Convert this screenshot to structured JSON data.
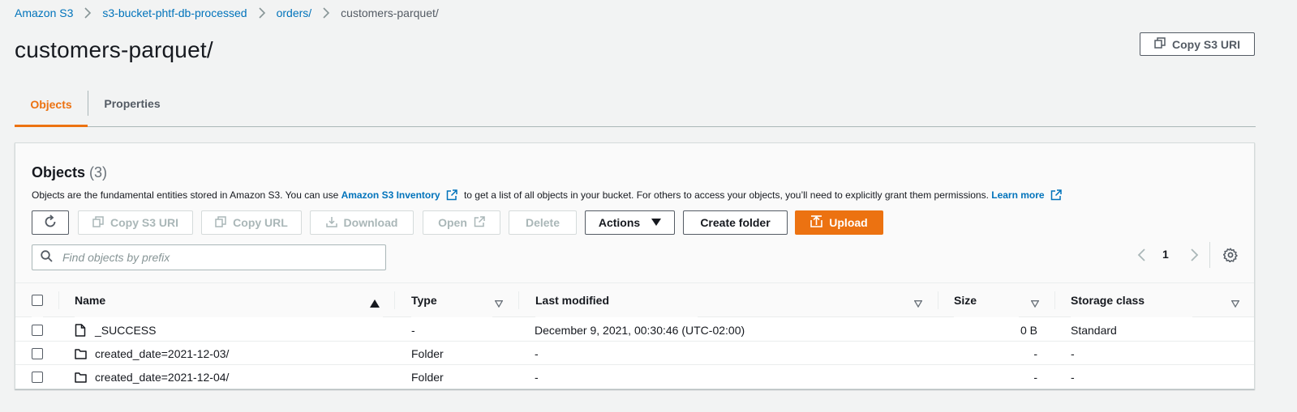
{
  "breadcrumb": {
    "items": [
      {
        "label": "Amazon S3"
      },
      {
        "label": "s3-bucket-phtf-db-processed"
      },
      {
        "label": "orders/"
      }
    ],
    "current": "customers-parquet/"
  },
  "page": {
    "title": "customers-parquet/",
    "copy_uri_label": "Copy S3 URI"
  },
  "tabs": [
    {
      "label": "Objects",
      "active": true
    },
    {
      "label": "Properties",
      "active": false
    }
  ],
  "objects_panel": {
    "title": "Objects",
    "count": "(3)",
    "description": {
      "part1": "Objects are the fundamental entities stored in Amazon S3. You can use ",
      "link1": "Amazon S3 Inventory",
      "part2": " to get a list of all objects in your bucket. For others to access your objects, you’ll need to explicitly grant them permissions. ",
      "link2": "Learn more"
    },
    "toolbar": {
      "copy_s3_uri": "Copy S3 URI",
      "copy_url": "Copy URL",
      "download": "Download",
      "open": "Open",
      "delete": "Delete",
      "actions": "Actions",
      "create_folder": "Create folder",
      "upload": "Upload"
    },
    "search": {
      "placeholder": "Find objects by prefix",
      "value": ""
    },
    "pagination": {
      "page": "1"
    },
    "columns": [
      "Name",
      "Type",
      "Last modified",
      "Size",
      "Storage class"
    ],
    "rows": [
      {
        "icon": "file-icon",
        "name": "_SUCCESS",
        "type": "-",
        "last_modified": "December 9, 2021, 00:30:46 (UTC-02:00)",
        "size": "0 B",
        "storage_class": "Standard"
      },
      {
        "icon": "folder-icon",
        "name": "created_date=2021-12-03/",
        "type": "Folder",
        "last_modified": "-",
        "size": "-",
        "storage_class": "-"
      },
      {
        "icon": "folder-icon",
        "name": "created_date=2021-12-04/",
        "type": "Folder",
        "last_modified": "-",
        "size": "-",
        "storage_class": "-"
      }
    ]
  },
  "colors": {
    "accent": "#ec7211",
    "link": "#0073bb",
    "text": "#16191f",
    "muted": "#545b64",
    "background": "#f2f3f3"
  }
}
